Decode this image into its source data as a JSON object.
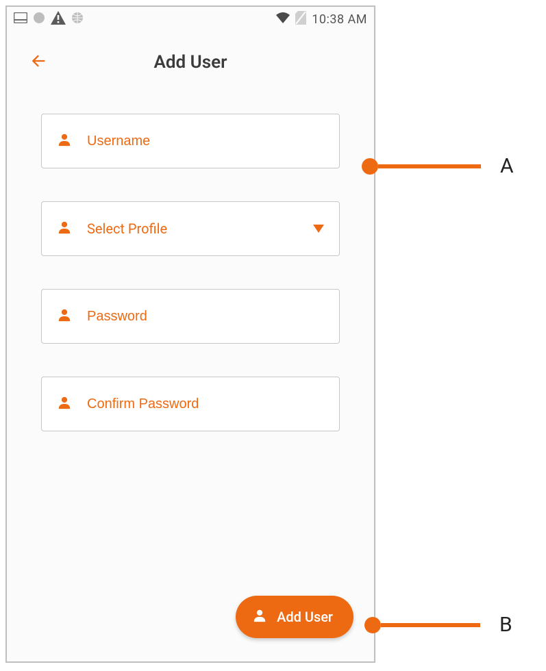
{
  "statusbar": {
    "time": "10:38 AM"
  },
  "header": {
    "title": "Add User"
  },
  "form": {
    "username_placeholder": "Username",
    "select_profile_label": "Select Profile",
    "password_placeholder": "Password",
    "confirm_password_placeholder": "Confirm Password"
  },
  "fab": {
    "label": "Add User"
  },
  "callouts": {
    "a": "A",
    "b": "B"
  },
  "colors": {
    "accent": "#ee6a12"
  }
}
